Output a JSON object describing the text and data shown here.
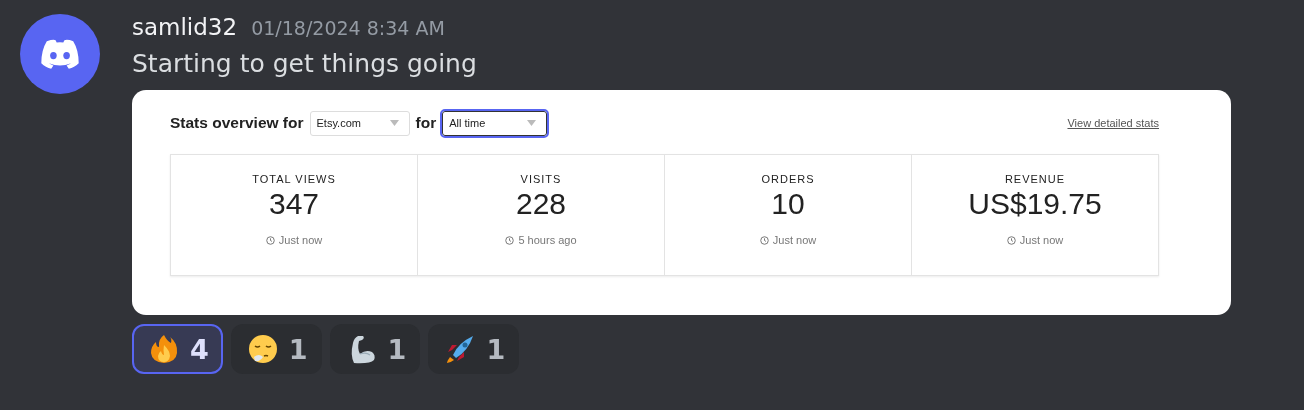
{
  "message": {
    "author": "samlid32",
    "timestamp": "01/18/2024 8:34 AM",
    "text": "Starting to get things going"
  },
  "embed": {
    "heading": "Stats overview for",
    "connector": "for",
    "link": "View detailed stats",
    "dropdowns": [
      {
        "value": "Etsy.com",
        "focused": false
      },
      {
        "value": "All time",
        "focused": true
      }
    ],
    "stats": [
      {
        "label": "TOTAL VIEWS",
        "value": "347",
        "updated": "Just now"
      },
      {
        "label": "VISITS",
        "value": "228",
        "updated": "5 hours ago"
      },
      {
        "label": "ORDERS",
        "value": "10",
        "updated": "Just now"
      },
      {
        "label": "REVENUE",
        "value": "US$19.75",
        "updated": "Just now"
      }
    ]
  },
  "reactions": [
    {
      "kind": "fire",
      "count": "4",
      "selected": true
    },
    {
      "kind": "sigh",
      "count": "1",
      "selected": false
    },
    {
      "kind": "muscle",
      "count": "1",
      "selected": false
    },
    {
      "kind": "rocket",
      "count": "1",
      "selected": false
    }
  ]
}
